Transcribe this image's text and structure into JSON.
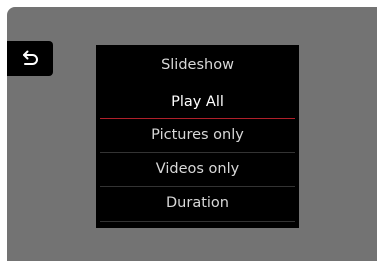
{
  "back_button": {
    "icon": "back-arrow-icon"
  },
  "menu": {
    "title": "Slideshow",
    "items": [
      {
        "label": "Play All",
        "selected": true
      },
      {
        "label": "Pictures only",
        "selected": false
      },
      {
        "label": "Videos only",
        "selected": false
      },
      {
        "label": "Duration",
        "selected": false
      }
    ]
  },
  "colors": {
    "screen_background": "#737373",
    "panel_background": "#000000",
    "accent": "#b0202a",
    "text": "#d8d8d8",
    "selected_text": "#ffffff"
  }
}
